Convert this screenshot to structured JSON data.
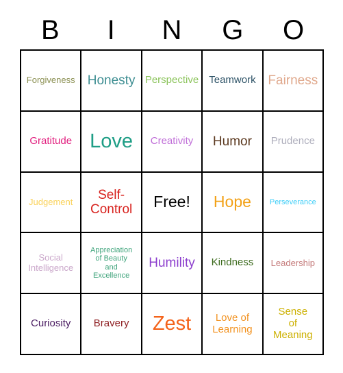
{
  "card": {
    "title": "BINGO",
    "header_letters": [
      "B",
      "I",
      "N",
      "G",
      "O"
    ],
    "grid_border_color": "#000000",
    "background_color": "#ffffff",
    "header_text_color": "#000000",
    "rows": 5,
    "columns": 5
  },
  "cells": [
    [
      {
        "label": "Forgiveness",
        "color": "#8c9154",
        "size": "sz-s"
      },
      {
        "label": "Honesty",
        "color": "#3e8e92",
        "size": "sz-l"
      },
      {
        "label": "Perspective",
        "color": "#8cc45c",
        "size": "sz-m"
      },
      {
        "label": "Teamwork",
        "color": "#2f5468",
        "size": "sz-m"
      },
      {
        "label": "Fairness",
        "color": "#e0a98d",
        "size": "sz-l"
      }
    ],
    [
      {
        "label": "Gratitude",
        "color": "#e11e7e",
        "size": "sz-m"
      },
      {
        "label": "Love",
        "color": "#1f9e86",
        "size": "sz-xxl"
      },
      {
        "label": "Creativity",
        "color": "#c06fd8",
        "size": "sz-m"
      },
      {
        "label": "Humor",
        "color": "#5c3a21",
        "size": "sz-l"
      },
      {
        "label": "Prudence",
        "color": "#aeaebc",
        "size": "sz-m"
      }
    ],
    [
      {
        "label": "Judgement",
        "color": "#fad25a",
        "size": "sz-s"
      },
      {
        "label": "Self-\nControl",
        "color": "#d8231f",
        "size": "sz-l"
      },
      {
        "label": "Free!",
        "color": "#000000",
        "size": "sz-xl"
      },
      {
        "label": "Hope",
        "color": "#f2a117",
        "size": "sz-xl"
      },
      {
        "label": "Perseverance",
        "color": "#3ccdf7",
        "size": "sz-xs"
      }
    ],
    [
      {
        "label": "Social\nIntelligence",
        "color": "#cba8cb",
        "size": "sz-s"
      },
      {
        "label": "Appreciation\nof Beauty\nand\nExcellence",
        "color": "#3da37a",
        "size": "sz-xs"
      },
      {
        "label": "Humility",
        "color": "#8c3ecd",
        "size": "sz-l"
      },
      {
        "label": "Kindness",
        "color": "#3d6b1e",
        "size": "sz-m"
      },
      {
        "label": "Leadership",
        "color": "#c47a7a",
        "size": "sz-s"
      }
    ],
    [
      {
        "label": "Curiosity",
        "color": "#4b1d62",
        "size": "sz-m"
      },
      {
        "label": "Bravery",
        "color": "#8e1f22",
        "size": "sz-m"
      },
      {
        "label": "Zest",
        "color": "#f4631a",
        "size": "sz-xxl"
      },
      {
        "label": "Love of\nLearning",
        "color": "#f29220",
        "size": "sz-m"
      },
      {
        "label": "Sense\nof\nMeaning",
        "color": "#ccb000",
        "size": "sz-m"
      }
    ]
  ]
}
